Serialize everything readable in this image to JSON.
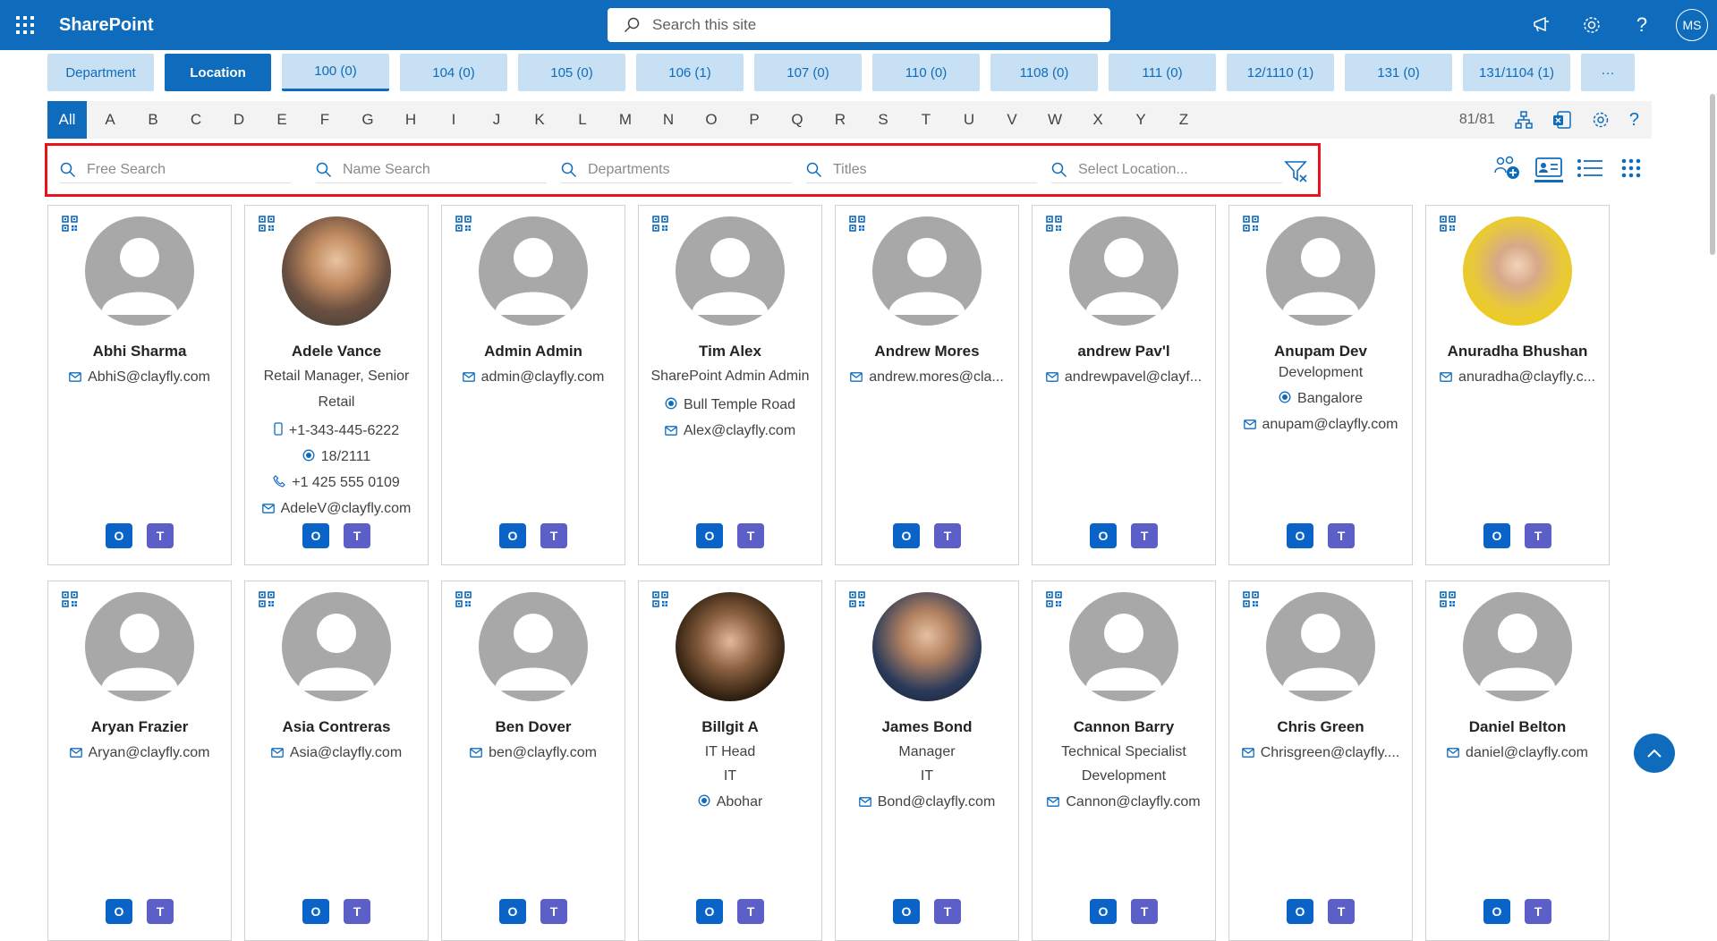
{
  "app": {
    "title": "SharePoint"
  },
  "search": {
    "placeholder": "Search this site"
  },
  "user": {
    "initials": "MS"
  },
  "tabs": [
    {
      "label": "Department"
    },
    {
      "label": "Location"
    },
    {
      "label": "100 (0)"
    },
    {
      "label": "104 (0)"
    },
    {
      "label": "105 (0)"
    },
    {
      "label": "106 (1)"
    },
    {
      "label": "107 (0)"
    },
    {
      "label": "110 (0)"
    },
    {
      "label": "1108 (0)"
    },
    {
      "label": "111 (0)"
    },
    {
      "label": "12/1110 (1)"
    },
    {
      "label": "131 (0)"
    },
    {
      "label": "131/1104 (1)"
    },
    {
      "label": "···"
    }
  ],
  "alphabet": [
    "All",
    "A",
    "B",
    "C",
    "D",
    "E",
    "F",
    "G",
    "H",
    "I",
    "J",
    "K",
    "L",
    "M",
    "N",
    "O",
    "P",
    "Q",
    "R",
    "S",
    "T",
    "U",
    "V",
    "W",
    "X",
    "Y",
    "Z"
  ],
  "count": "81/81",
  "filters": {
    "free": "Free Search",
    "name": "Name Search",
    "departments": "Departments",
    "titles": "Titles",
    "location": "Select Location..."
  },
  "people": [
    {
      "name": "Abhi Sharma",
      "lines": [
        {
          "icon": "mail-icon",
          "text": "AbhiS@clayfly.com"
        }
      ],
      "photo": "placeholder"
    },
    {
      "name": "Adele Vance",
      "title": "Retail Manager, Senior Retail",
      "lines": [
        {
          "icon": "mobile-icon",
          "text": "+1-343-445-6222"
        },
        {
          "icon": "location-icon",
          "text": "18/2111"
        },
        {
          "icon": "phone-icon",
          "text": "+1 425 555 0109"
        },
        {
          "icon": "mail-icon",
          "text": "AdeleV@clayfly.com"
        }
      ],
      "photo": "real"
    },
    {
      "name": "Admin Admin",
      "lines": [
        {
          "icon": "mail-icon",
          "text": "admin@clayfly.com"
        }
      ],
      "photo": "placeholder"
    },
    {
      "name": "Tim Alex",
      "title": "SharePoint Admin Admin",
      "lines": [
        {
          "icon": "location-icon",
          "text": "Bull Temple Road"
        },
        {
          "icon": "mail-icon",
          "text": "Alex@clayfly.com"
        }
      ],
      "photo": "placeholder"
    },
    {
      "name": "Andrew Mores",
      "lines": [
        {
          "icon": "mail-icon",
          "text": "andrew.mores@cla..."
        }
      ],
      "photo": "placeholder"
    },
    {
      "name": "andrew Pav'l",
      "lines": [
        {
          "icon": "mail-icon",
          "text": "andrewpavel@clayf..."
        }
      ],
      "photo": "placeholder"
    },
    {
      "name": "Anupam Dev",
      "dept": "Development",
      "lines": [
        {
          "icon": "location-icon",
          "text": "Bangalore"
        },
        {
          "icon": "mail-icon",
          "text": "anupam@clayfly.com"
        }
      ],
      "photo": "placeholder"
    },
    {
      "name": "Anuradha Bhushan",
      "lines": [
        {
          "icon": "mail-icon",
          "text": "anuradha@clayfly.c..."
        }
      ],
      "photo": "real-gold"
    },
    {
      "name": "Aryan Frazier",
      "lines": [
        {
          "icon": "mail-icon",
          "text": "Aryan@clayfly.com"
        }
      ],
      "photo": "placeholder"
    },
    {
      "name": "Asia Contreras",
      "lines": [
        {
          "icon": "mail-icon",
          "text": "Asia@clayfly.com"
        }
      ],
      "photo": "placeholder"
    },
    {
      "name": "Ben Dover",
      "lines": [
        {
          "icon": "mail-icon",
          "text": "ben@clayfly.com"
        }
      ],
      "photo": "placeholder"
    },
    {
      "name": "Billgit A",
      "title": "IT Head",
      "dept": "IT",
      "lines": [
        {
          "icon": "location-icon",
          "text": "Abohar"
        }
      ],
      "photo": "real-dark"
    },
    {
      "name": "James Bond",
      "title": "Manager",
      "dept": "IT",
      "lines": [
        {
          "icon": "mail-icon",
          "text": "Bond@clayfly.com"
        }
      ],
      "photo": "real-suit"
    },
    {
      "name": "Cannon Barry",
      "title": "Technical Specialist",
      "dept": "Development",
      "lines": [
        {
          "icon": "mail-icon",
          "text": "Cannon@clayfly.com"
        }
      ],
      "photo": "placeholder"
    },
    {
      "name": "Chris Green",
      "lines": [
        {
          "icon": "mail-icon",
          "text": "Chrisgreen@clayfly...."
        }
      ],
      "photo": "placeholder"
    },
    {
      "name": "Daniel Belton",
      "lines": [
        {
          "icon": "mail-icon",
          "text": "daniel@clayfly.com"
        }
      ],
      "photo": "placeholder"
    }
  ],
  "colors": {
    "brand": "#0f6cbd",
    "highlight": "#e8141c"
  }
}
